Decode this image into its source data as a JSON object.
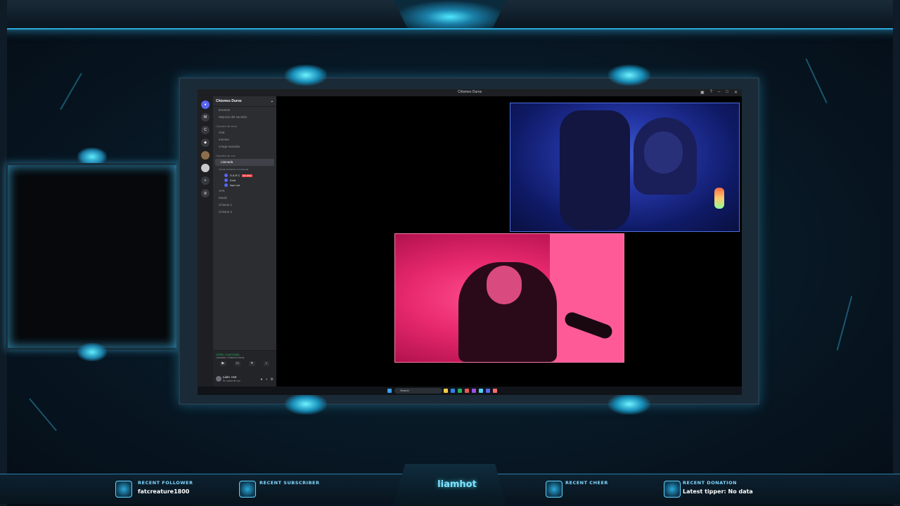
{
  "colors": {
    "accent": "#3cd2ff",
    "discord_bg": "#2b2d31",
    "online": "#23a55a"
  },
  "discord": {
    "window_title": "Chismes Duros",
    "server_name": "Chismes Duros",
    "nav_items": [
      "Eventos",
      "Mejoras del servidor"
    ],
    "text_category": "Canales de texto",
    "text_channels": [
      "chat",
      "memes",
      "cringe-susudos"
    ],
    "voice_category": "Canales de voz",
    "active_voice": "Llamada",
    "active_voice_sub": "Intentar visualizar en la llamada",
    "members": [
      "S.A.R.C",
      "Emd",
      "liam.hot"
    ],
    "member_tag": "EN VIVO",
    "other_voice": [
      "AFK",
      "Musik",
      "Chisme 1",
      "Chisme 2"
    ],
    "voice_status": "Vídeo conectado",
    "voice_status_sub": "Llamada / Chismes Duros",
    "user_name": "Liam. Hot",
    "user_status": "En canal de voz",
    "search_placeholder": "Search"
  },
  "stream": {
    "channel": "liamhot",
    "recent_follower_label": "RECENT FOLLOWER",
    "recent_follower": "fatcreature1800",
    "recent_subscriber_label": "RECENT SUBSCRIBER",
    "recent_subscriber": "",
    "recent_cheer_label": "RECENT CHEER",
    "recent_cheer": "",
    "recent_donation_label": "RECENT DONATION",
    "recent_donation": "Latest tipper: No data"
  }
}
